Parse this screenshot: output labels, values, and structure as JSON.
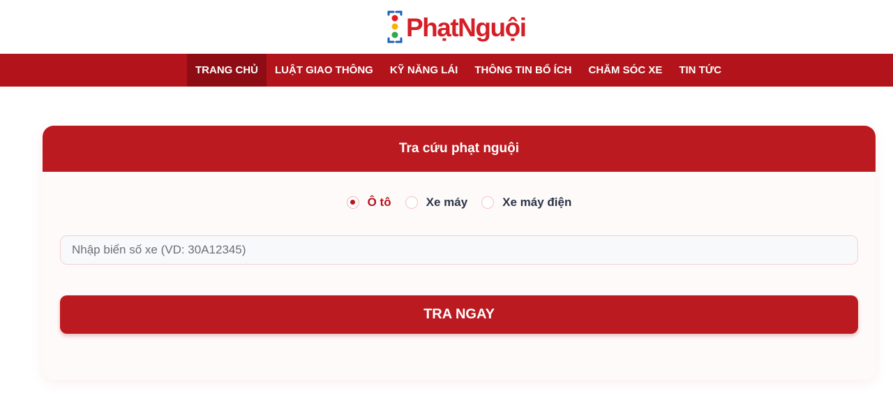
{
  "brand": {
    "logo_text": "PhạtNguội",
    "icon": "traffic-light-icon",
    "colors": {
      "primary": "#bb1a20",
      "nav": "#b3131b",
      "nav_active": "#8e0d14",
      "logo_text": "#d41f26"
    }
  },
  "nav": {
    "items": [
      {
        "label": "TRANG CHỦ",
        "active": true
      },
      {
        "label": "LUẬT GIAO THÔNG",
        "active": false
      },
      {
        "label": "KỸ NĂNG LÁI",
        "active": false
      },
      {
        "label": "THÔNG TIN BỔ ÍCH",
        "active": false
      },
      {
        "label": "CHĂM SÓC XE",
        "active": false
      },
      {
        "label": "TIN TỨC",
        "active": false
      }
    ]
  },
  "lookup": {
    "title": "Tra cứu phạt nguội",
    "vehicle_types": [
      {
        "label": "Ô tô",
        "checked": true
      },
      {
        "label": "Xe máy",
        "checked": false
      },
      {
        "label": "Xe máy điện",
        "checked": false
      }
    ],
    "plate_input": {
      "value": "",
      "placeholder": "Nhập biển số xe (VD: 30A12345)"
    },
    "submit_label": "TRA NGAY"
  }
}
